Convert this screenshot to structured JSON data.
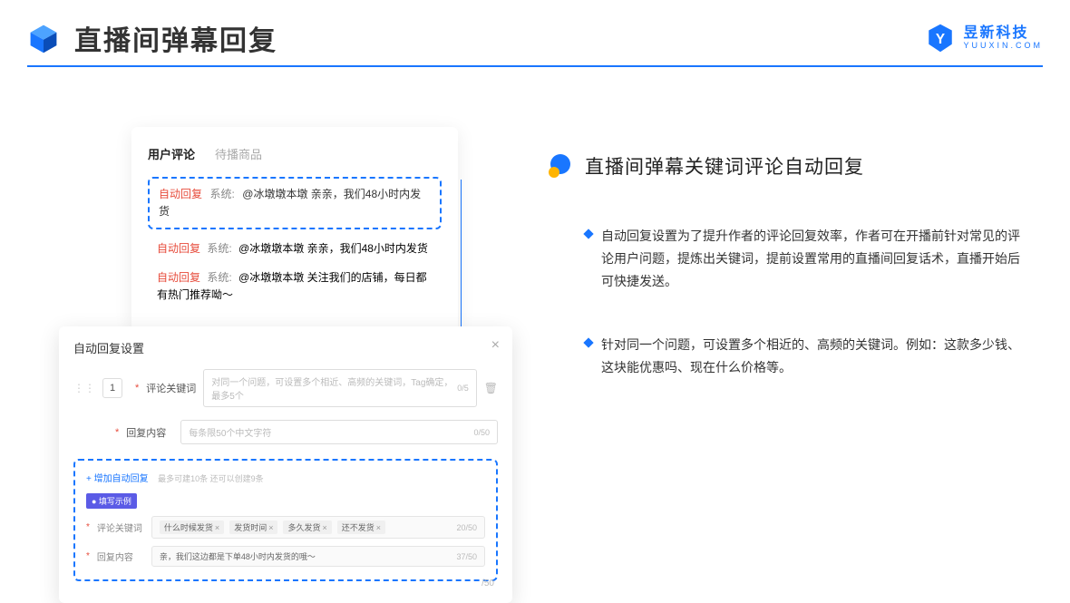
{
  "page": {
    "title": "直播间弹幕回复"
  },
  "brand": {
    "name": "昱新科技",
    "url": "YUUXIN.COM"
  },
  "commentCard": {
    "tab1": "用户评论",
    "tab2": "待播商品",
    "highlighted": "@冰墩墩本墩 亲亲，我们48小时内发货",
    "row2": "@冰墩墩本墩 亲亲，我们48小时内发货",
    "row3": "@冰墩墩本墩 关注我们的店铺，每日都有热门推荐呦～",
    "autoTag": "自动回复",
    "sysTag": "系统:"
  },
  "settings": {
    "title": "自动回复设置",
    "num": "1",
    "label1": "评论关键词",
    "ph1": "对同一个问题，可设置多个相近、高频的关键词，Tag确定，最多5个",
    "c1": "0/5",
    "label2": "回复内容",
    "ph2": "每条限50个中文字符",
    "c2": "0/50",
    "addLink": "+ 增加自动回复",
    "addHint": "最多可建10条 还可以创建9条",
    "exampleBadge": "● 填写示例",
    "exLabel1": "评论关键词",
    "tag1": "什么时候发货",
    "tag2": "发货时间",
    "tag3": "多久发货",
    "tag4": "还不发货",
    "exC1": "20/50",
    "exLabel2": "回复内容",
    "exVal2": "亲，我们这边都是下单48小时内发货的哦～",
    "exC2": "37/50",
    "belowCounter": "/50"
  },
  "right": {
    "sectionTitle": "直播间弹幕关键词评论自动回复",
    "bullet1": "自动回复设置为了提升作者的评论回复效率，作者可在开播前针对常见的评论用户问题，提炼出关键词，提前设置常用的直播间回复话术，直播开始后可快捷发送。",
    "bullet2": "针对同一个问题，可设置多个相近的、高频的关键词。例如：这款多少钱、这块能优惠吗、现在什么价格等。"
  }
}
